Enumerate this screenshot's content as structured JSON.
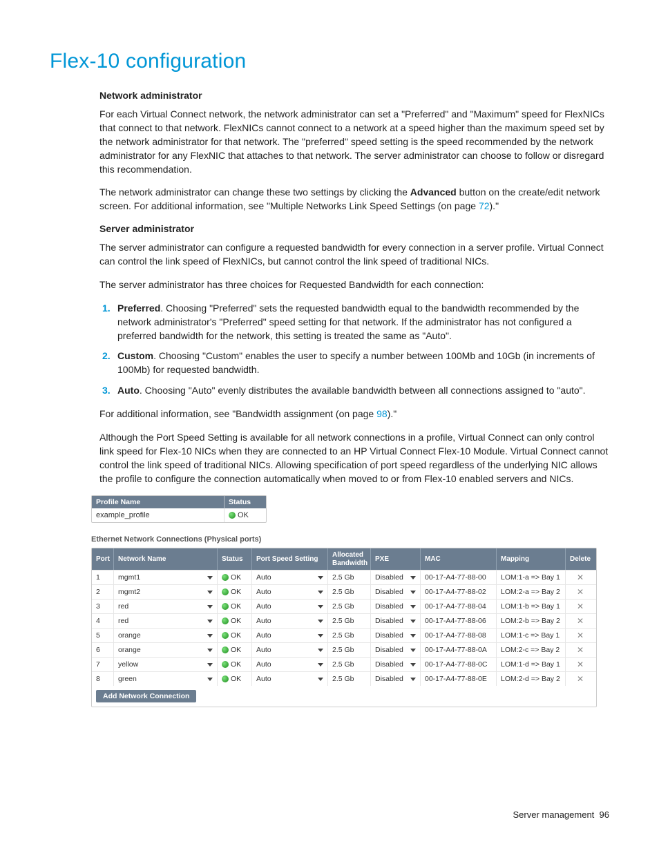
{
  "title": "Flex-10 configuration",
  "sections": {
    "network_admin_heading": "Network administrator",
    "network_admin_p1": "For each Virtual Connect network, the network administrator can set a \"Preferred\" and \"Maximum\" speed for FlexNICs that connect to that network. FlexNICs cannot connect to a network at a speed higher than the maximum speed set by the network administrator for that network. The \"preferred\" speed setting is the speed recommended by the network administrator for any FlexNIC that attaches to that network. The server administrator can choose to follow or disregard this recommendation.",
    "network_admin_p2_a": "The network administrator can change these two settings by clicking the ",
    "network_admin_p2_bold": "Advanced",
    "network_admin_p2_b": " button on the create/edit network screen. For additional information, see \"Multiple Networks Link Speed Settings (on page ",
    "network_admin_p2_link": "72",
    "network_admin_p2_c": ").\"",
    "server_admin_heading": "Server administrator",
    "server_admin_p1": "The server administrator can configure a requested bandwidth for every connection in a server profile. Virtual Connect can control the link speed of FlexNICs, but cannot control the link speed of traditional NICs.",
    "server_admin_p2": "The server administrator has three choices for Requested Bandwidth for each connection:",
    "options": [
      {
        "name": "Preferred",
        "text": ". Choosing \"Preferred\" sets the requested bandwidth equal to the bandwidth recommended by the network administrator's \"Preferred\" speed setting for that network. If the administrator has not configured a preferred bandwidth for the network, this setting is treated the same as \"Auto\"."
      },
      {
        "name": "Custom",
        "text": ". Choosing \"Custom\" enables the user to specify a number between 100Mb and 10Gb (in increments of 100Mb) for requested bandwidth."
      },
      {
        "name": "Auto",
        "text": ". Choosing \"Auto\" evenly distributes the available bandwidth between all connections assigned to \"auto\"."
      }
    ],
    "after_list_a": "For additional information, see \"Bandwidth assignment (on page ",
    "after_list_link": "98",
    "after_list_b": ").\"",
    "closing_p": "Although the Port Speed Setting is available for all network connections in a profile, Virtual Connect can only control link speed for Flex-10 NICs when they are connected to an HP Virtual Connect Flex-10 Module. Virtual Connect cannot control the link speed of traditional NICs. Allowing specification of port speed regardless of the underlying NIC allows the profile to configure the connection automatically when moved to or from Flex-10 enabled servers and NICs."
  },
  "profile_table": {
    "headers": {
      "name": "Profile Name",
      "status": "Status"
    },
    "row": {
      "name": "example_profile",
      "status": "OK"
    }
  },
  "conn_section_label": "Ethernet Network Connections (Physical ports)",
  "conn_headers": {
    "port": "Port",
    "network": "Network Name",
    "status": "Status",
    "speed": "Port Speed Setting",
    "bw": "Allocated Bandwidth",
    "pxe": "PXE",
    "mac": "MAC",
    "mapping": "Mapping",
    "delete": "Delete"
  },
  "conn_rows": [
    {
      "port": "1",
      "network": "mgmt1",
      "status": "OK",
      "speed": "Auto",
      "bw": "2.5 Gb",
      "pxe": "Disabled",
      "mac": "00-17-A4-77-88-00",
      "mapping": "LOM:1-a => Bay 1"
    },
    {
      "port": "2",
      "network": "mgmt2",
      "status": "OK",
      "speed": "Auto",
      "bw": "2.5 Gb",
      "pxe": "Disabled",
      "mac": "00-17-A4-77-88-02",
      "mapping": "LOM:2-a => Bay 2"
    },
    {
      "port": "3",
      "network": "red",
      "status": "OK",
      "speed": "Auto",
      "bw": "2.5 Gb",
      "pxe": "Disabled",
      "mac": "00-17-A4-77-88-04",
      "mapping": "LOM:1-b => Bay 1"
    },
    {
      "port": "4",
      "network": "red",
      "status": "OK",
      "speed": "Auto",
      "bw": "2.5 Gb",
      "pxe": "Disabled",
      "mac": "00-17-A4-77-88-06",
      "mapping": "LOM:2-b => Bay 2"
    },
    {
      "port": "5",
      "network": "orange",
      "status": "OK",
      "speed": "Auto",
      "bw": "2.5 Gb",
      "pxe": "Disabled",
      "mac": "00-17-A4-77-88-08",
      "mapping": "LOM:1-c => Bay 1"
    },
    {
      "port": "6",
      "network": "orange",
      "status": "OK",
      "speed": "Auto",
      "bw": "2.5 Gb",
      "pxe": "Disabled",
      "mac": "00-17-A4-77-88-0A",
      "mapping": "LOM:2-c => Bay 2"
    },
    {
      "port": "7",
      "network": "yellow",
      "status": "OK",
      "speed": "Auto",
      "bw": "2.5 Gb",
      "pxe": "Disabled",
      "mac": "00-17-A4-77-88-0C",
      "mapping": "LOM:1-d => Bay 1"
    },
    {
      "port": "8",
      "network": "green",
      "status": "OK",
      "speed": "Auto",
      "bw": "2.5 Gb",
      "pxe": "Disabled",
      "mac": "00-17-A4-77-88-0E",
      "mapping": "LOM:2-d => Bay 2"
    }
  ],
  "add_button": "Add Network Connection",
  "footer": {
    "text": "Server management",
    "page": "96"
  }
}
